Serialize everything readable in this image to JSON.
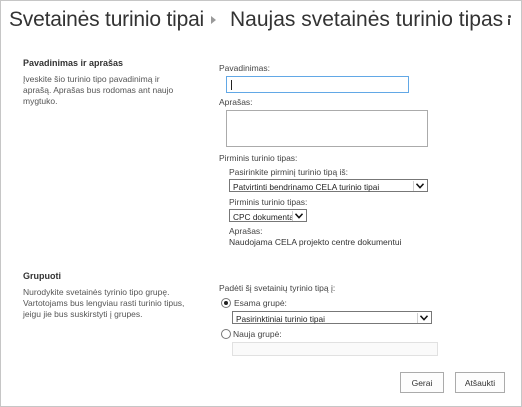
{
  "header": {
    "breadcrumb_parent": "Svetainės turinio tipai",
    "page_title": "Naujas svetainės turinio tipas"
  },
  "name_section": {
    "heading": "Pavadinimas ir aprašas",
    "description": "Įveskite šio turinio tipo pavadinimą ir aprašą. Aprašas bus rodomas ant naujo mygtuko.",
    "name_label": "Pavadinimas:",
    "name_value": "",
    "description_label": "Aprašas:",
    "description_value": "",
    "parent_type_label": "Pirminis turinio tipas:",
    "select_parent_from_label": "Pasirinkite pirminį turinio tipą iš:",
    "select_parent_from_value": "Patvirtinti bendrinamo CELA turinio tipai",
    "parent_type_sub_label": "Pirminis turinio tipas:",
    "parent_type_value": "CPC dokumentas",
    "parent_desc_label": "Aprašas:",
    "parent_desc_value": "Naudojama CELA projekto centre dokumentui"
  },
  "group_section": {
    "heading": "Grupuoti",
    "description": "Nurodykite svetainės tyrinio tipo grupę. Vartotojams bus lengviau rasti turinio tipus, jeigu jie bus suskirstyti į grupes.",
    "put_into_label": "Padėti šį svetainių tyrinio tipą į:",
    "existing_group_label": "Esama grupė:",
    "existing_group_value": "Pasirinktiniai turinio tipai",
    "new_group_label": "Nauja grupė:",
    "new_group_value": ""
  },
  "buttons": {
    "ok": "Gerai",
    "cancel": "Atšaukti"
  },
  "icons": {
    "info": "info-icon",
    "breadcrumb_separator": "chevron-right-icon",
    "dropdown": "chevron-down-icon"
  }
}
